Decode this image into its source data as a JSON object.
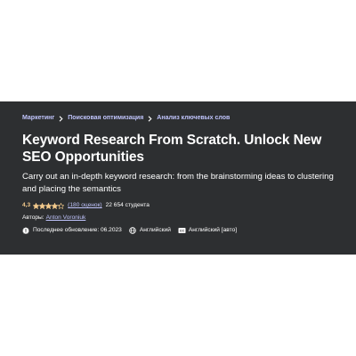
{
  "breadcrumb": {
    "items": [
      {
        "label": "Маркетинг"
      },
      {
        "label": "Поисковая оптимизация"
      },
      {
        "label": "Анализ ключевых слов"
      }
    ],
    "separator_icon": "chevron-right-icon"
  },
  "course": {
    "title": "Keyword Research From Scratch. Unlock New SEO Opportunities",
    "subtitle": "Carry out an in-depth keyword research: from the brainstorming ideas to clustering and placing the semantics",
    "rating": {
      "value": "4,3",
      "stars": 4.3,
      "max_stars": 5,
      "count_text": "(180 оценок)",
      "star_color": "#f3ca8c"
    },
    "students": "22 654 студента",
    "authors_label": "Авторы:",
    "author": "Anton Voroniuk",
    "meta": {
      "updated_icon": "alert-badge-icon",
      "updated": "Последнее обновление: 06.2023",
      "language_icon": "globe-icon",
      "language": "Английский",
      "captions_icon": "closed-captions-icon",
      "captions": "Английский [авто]"
    }
  },
  "colors": {
    "banner_bg": "#2d2f31",
    "link": "#c0c4fc",
    "text": "#ffffff",
    "page_bg": "#ffffff"
  }
}
